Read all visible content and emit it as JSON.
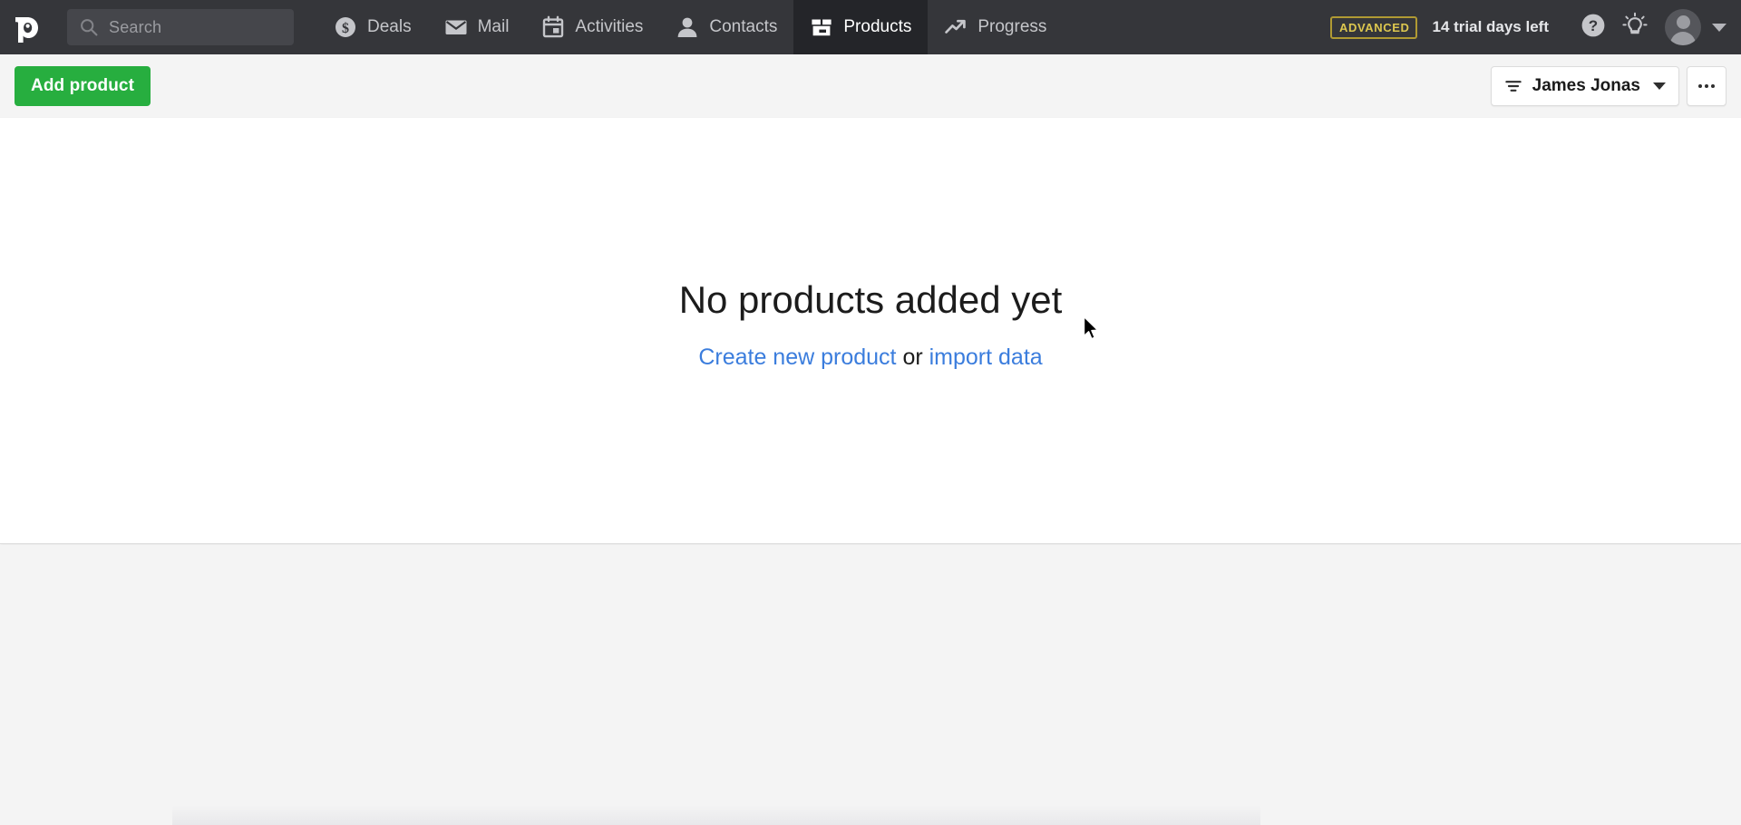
{
  "app": {
    "name": "Pipedrive",
    "logo_icon": "pipedrive-p-logo"
  },
  "topbar": {
    "search": {
      "placeholder": "Search",
      "value": "",
      "icon": "search-icon"
    },
    "nav_items": [
      {
        "label": "Deals",
        "icon": "dollar-coin-icon",
        "active": false
      },
      {
        "label": "Mail",
        "icon": "envelope-icon",
        "active": false
      },
      {
        "label": "Activities",
        "icon": "calendar-icon",
        "active": false
      },
      {
        "label": "Contacts",
        "icon": "person-icon",
        "active": false
      },
      {
        "label": "Products",
        "icon": "box-icon",
        "active": true
      },
      {
        "label": "Progress",
        "icon": "trending-up-icon",
        "active": false
      }
    ],
    "plan_badge": "ADVANCED",
    "trial_text": "14 trial days left",
    "help_icon": "question-mark-circle-icon",
    "tips_icon": "lightbulb-icon",
    "avatar_icon": "user-avatar",
    "avatar_caret_icon": "chevron-down-icon"
  },
  "toolbar": {
    "add_product_label": "Add product",
    "filter": {
      "icon": "filter-icon",
      "label": "James Jonas",
      "caret_icon": "chevron-down-icon"
    },
    "more_options_icon": "ellipsis-horizontal-icon"
  },
  "main": {
    "empty_state": {
      "title": "No products added yet",
      "create_link": "Create new product",
      "separator": " or ",
      "import_link": "import data"
    }
  },
  "colors": {
    "nav_bg": "#35363a",
    "nav_active_bg": "#242529",
    "primary_green": "#27ae3f",
    "link_blue": "#3b7ddd",
    "badge_gold": "#ddc74f",
    "page_bg": "#f4f4f4",
    "panel_bg": "#ffffff"
  }
}
